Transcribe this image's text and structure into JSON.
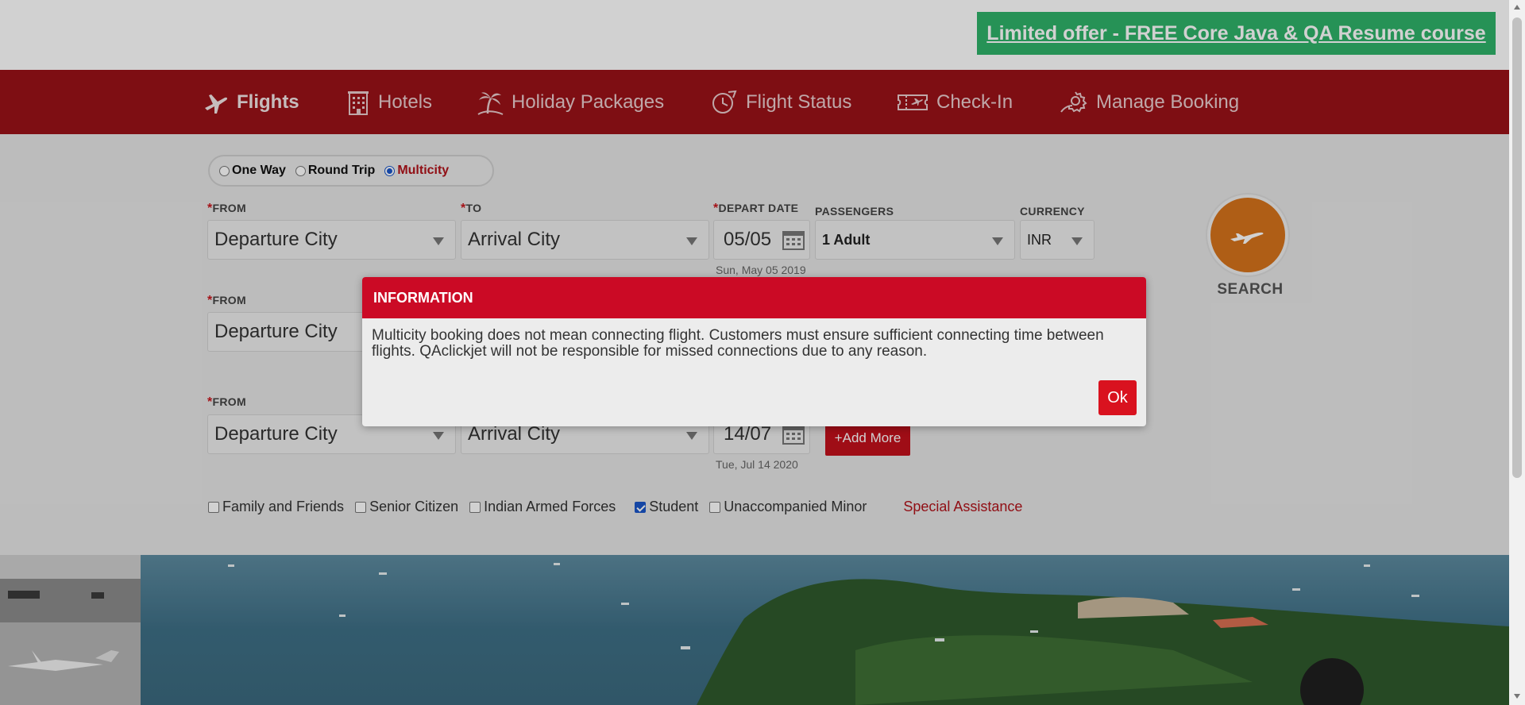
{
  "offer": {
    "label": "Limited offer - FREE Core Java & QA Resume course"
  },
  "nav": {
    "items": [
      {
        "label": "Flights",
        "icon": "plane-icon"
      },
      {
        "label": "Hotels",
        "icon": "building-icon"
      },
      {
        "label": "Holiday Packages",
        "icon": "palm-tree-icon"
      },
      {
        "label": "Flight Status",
        "icon": "clock-icon"
      },
      {
        "label": "Check-In",
        "icon": "ticket-icon"
      },
      {
        "label": "Manage Booking",
        "icon": "gear-icon"
      }
    ]
  },
  "trip": {
    "options": [
      "One Way",
      "Round Trip",
      "Multicity"
    ],
    "selected": "Multicity"
  },
  "labels": {
    "from": "FROM",
    "to": "TO",
    "depart": "DEPART DATE",
    "passengers": "PASSENGERS",
    "currency": "CURRENCY",
    "required": "*"
  },
  "rows": [
    {
      "from": "Departure City",
      "to": "Arrival City",
      "date": "05/05",
      "subdate": "Sun, May 05 2019"
    },
    {
      "from": "Departure City",
      "to": "",
      "date": "",
      "subdate": ""
    },
    {
      "from": "Departure City",
      "to": "Arrival City",
      "date": "14/07",
      "subdate": "Tue, Jul 14 2020"
    }
  ],
  "passengers": {
    "value": "1 Adult"
  },
  "currency": {
    "value": "INR"
  },
  "add_more": {
    "label": "+Add More"
  },
  "search": {
    "label": "SEARCH"
  },
  "checkboxes": [
    {
      "label": "Family and Friends",
      "checked": false
    },
    {
      "label": "Senior Citizen",
      "checked": false
    },
    {
      "label": "Indian Armed Forces",
      "checked": false
    },
    {
      "label": "Student",
      "checked": true
    },
    {
      "label": "Unaccompanied Minor",
      "checked": false
    }
  ],
  "special_assistance": {
    "label": "Special Assistance"
  },
  "modal": {
    "title": "INFORMATION",
    "body": "Multicity booking does not mean connecting flight. Customers must ensure sufficient connecting time between flights. QAclickjet will not be responsible for missed connections due to any reason.",
    "ok_label": "Ok"
  },
  "colors": {
    "nav_bg": "#9a1218",
    "offer_bg": "#2fb36a",
    "modal_header": "#cb0a25",
    "accent_red": "#c2101c",
    "search_orange": "#d6731c"
  }
}
